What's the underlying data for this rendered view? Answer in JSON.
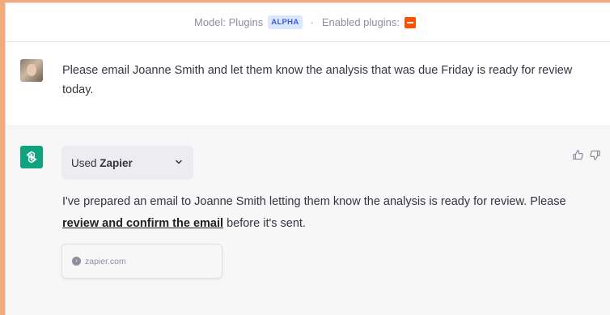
{
  "header": {
    "model_label": "Model: Plugins",
    "alpha_badge": "ALPHA",
    "separator": "·",
    "enabled_label": "Enabled plugins:",
    "plugin_icon": "zapier-icon"
  },
  "user_message": {
    "text": "Please email Joanne Smith and let them know the analysis that was due Friday is ready for review today."
  },
  "assistant_message": {
    "plugin_prefix": "Used",
    "plugin_name": "Zapier",
    "text_before_link": "I've prepared an email to Joanne Smith letting them know the analysis is ready for review. Please ",
    "link_text": "review and confirm the email",
    "text_after_link": " before it's sent.",
    "source": "zapier.com"
  },
  "colors": {
    "accent_green": "#10a37f",
    "zapier_orange": "#ff4f00",
    "window_frame": "#f4ab7c"
  }
}
